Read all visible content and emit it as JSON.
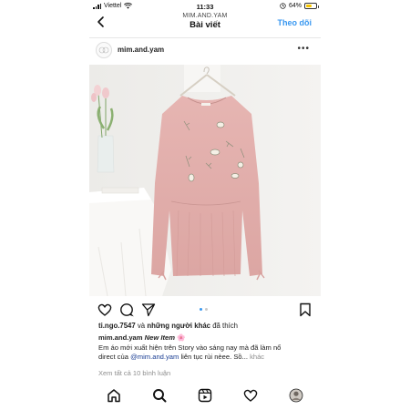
{
  "status_bar": {
    "carrier": "Viettel",
    "time": "11:33",
    "battery_percent": "64%",
    "battery_level": 0.64,
    "icons": [
      "signal-icon",
      "wifi-icon",
      "location-icon",
      "battery-icon"
    ]
  },
  "header": {
    "account": "MIM.AND.YAM",
    "title": "Bài viết",
    "follow_label": "Theo dõi",
    "follow_color": "#3897f0"
  },
  "post": {
    "username": "mim.and.yam",
    "more_label": "•••",
    "carousel": {
      "pages": 2,
      "current": 1
    },
    "likes": {
      "liker": "ti.ngo.7547",
      "joiner": "và",
      "others": "những người khác",
      "suffix": "đã thích"
    },
    "caption": {
      "username": "mim.and.yam",
      "tag": "New Item",
      "emoji": "🌸",
      "line1": "Em áo mới xuất hiện trên Story vào sáng nay mà đã làm nổ",
      "line2_prefix": "direct của",
      "mention": "@mim.and.yam",
      "line2_suffix": "liên tục rùi nèee. Sồ...",
      "more": "khác"
    },
    "comments_link": "Xem tất cả 10 bình luận"
  },
  "bottom_nav": [
    "home-icon",
    "search-icon",
    "reels-icon",
    "heart-icon",
    "profile-avatar"
  ]
}
